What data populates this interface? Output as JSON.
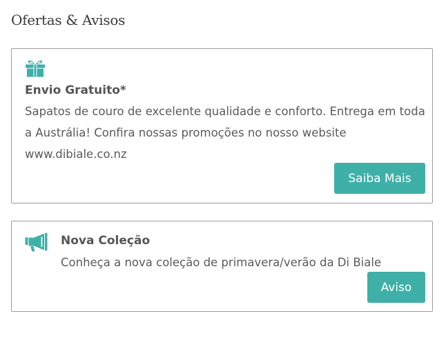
{
  "section": {
    "title": "Ofertas & Avisos"
  },
  "colors": {
    "accent": "#3fb0a8",
    "border": "#9b9b9b",
    "text": "#5a5a5a"
  },
  "cards": [
    {
      "icon": "gift-icon",
      "title": "Envio Gratuito*",
      "text": "Sapatos de couro de excelente qualidade e conforto. Entrega em toda a Austrália! Confira nossas promoções no nosso website www.dibiale.co.nz",
      "button_label": "Saiba Mais"
    },
    {
      "icon": "megaphone-icon",
      "title": "Nova Coleção",
      "text": "Conheça a nova coleção de primavera/verão da Di Biale",
      "button_label": "Aviso"
    }
  ]
}
